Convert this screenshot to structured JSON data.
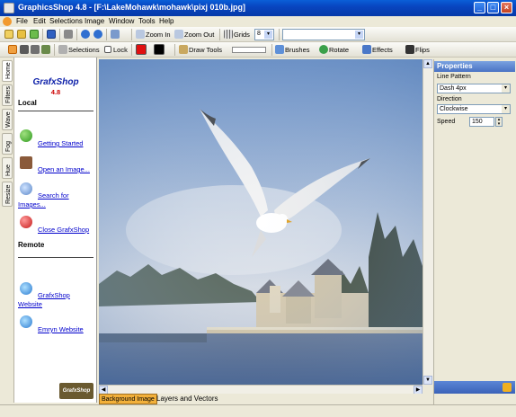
{
  "window": {
    "title": "GraphicsShop 4.8 - [F:\\LakeMohawk\\mohawk\\pixj 010b.jpg]"
  },
  "menu": [
    "File",
    "Edit",
    "Selections",
    "Image",
    "Window",
    "Tools",
    "Help"
  ],
  "toolbar1": {
    "zoom_in": "Zoom In",
    "zoom_out": "Zoom Out",
    "grids": "Grids",
    "grid_value": "8"
  },
  "toolbar2": {
    "selections": "Selections",
    "lock": "Lock",
    "draw_tools": "Draw Tools",
    "brushes": "Brushes",
    "rotate": "Rotate",
    "effects": "Effects",
    "flips": "Flips"
  },
  "side_tabs": [
    "Home",
    "Filters",
    "Wave",
    "Fog",
    "Hue",
    "Resize"
  ],
  "left_panel": {
    "logo": "GrafxShop",
    "version": "4.8",
    "local_heading": "Local",
    "remote_heading": "Remote",
    "links": {
      "getting_started": "Getting Started",
      "open_image": "Open an Image...",
      "search_l1": "Search for",
      "search_l2": "Images...",
      "close": "Close GrafxShop",
      "website_l1": "GrafxShop",
      "website_l2": "Website",
      "emryn": "Emryn Website"
    },
    "footer_logo": "GrafxShop"
  },
  "tabs": {
    "background": "Background Image",
    "layers": "Layers and Vectors"
  },
  "properties": {
    "title": "Properties",
    "line_pattern_label": "Line Pattern",
    "line_pattern_value": "Dash 4px",
    "direction_label": "Direction",
    "direction_value": "Clockwise",
    "speed_label": "Speed",
    "speed_value": "150"
  },
  "colors": {
    "primary": "#e01010",
    "secondary": "#000000"
  }
}
